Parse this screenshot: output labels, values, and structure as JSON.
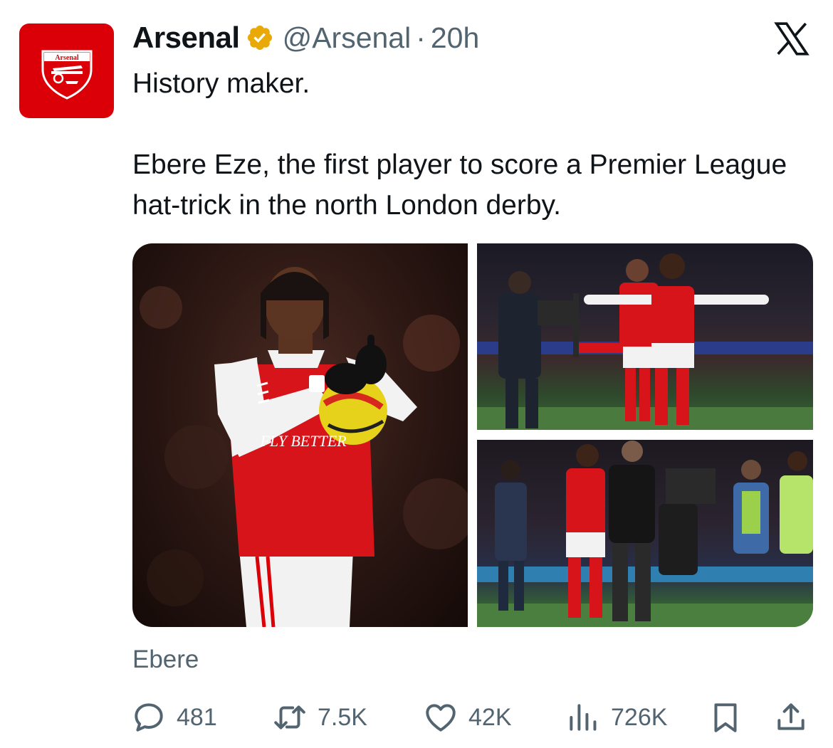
{
  "account": {
    "display_name": "Arsenal",
    "handle": "@Arsenal",
    "separator": "·",
    "time_ago": "20h",
    "avatar_text": "Arsenal",
    "verified_icon": "verified-badge-icon"
  },
  "post": {
    "line1": "History maker.",
    "line2": "Ebere Eze, the first player to score a Premier League hat-trick in the north London derby."
  },
  "media": {
    "photos": [
      "photo-main-player-with-ball",
      "photo-celebration-stadium",
      "photo-celebration-manager"
    ],
    "shirt_text": "FLY BETTER"
  },
  "source_label": "Ebere",
  "actions": {
    "replies": "481",
    "reposts": "7.5K",
    "likes": "42K",
    "views": "726K"
  },
  "colors": {
    "brand": "#db0007",
    "text_primary": "#0f1419",
    "text_secondary": "#536471",
    "verified": "#e8a909"
  }
}
